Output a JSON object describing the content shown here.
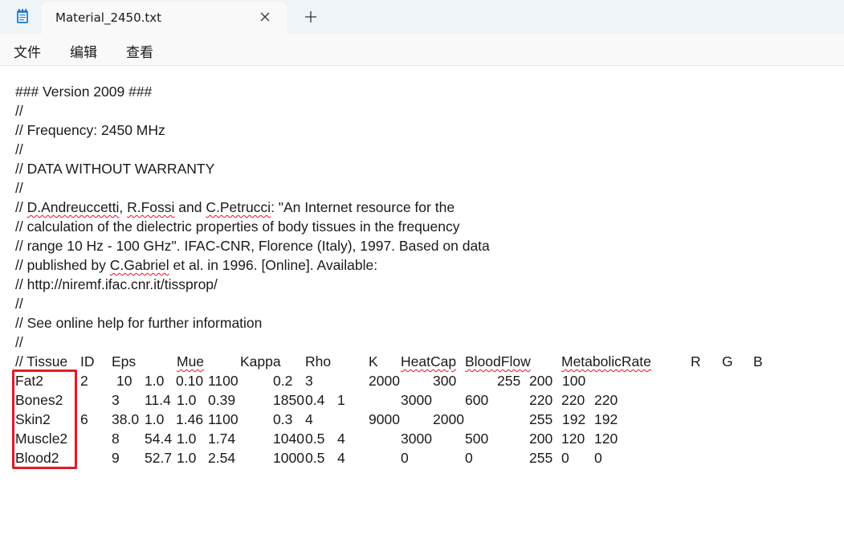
{
  "window": {
    "tab_title": "Material_2450.txt",
    "icons": {
      "app": "notepad-icon",
      "close": "close-icon",
      "new_tab": "plus-icon"
    }
  },
  "menu": {
    "file": "文件",
    "edit": "编辑",
    "view": "查看"
  },
  "header_lines": [
    "### Version 2009 ###",
    "//",
    "// Frequency: 2450 MHz",
    "//",
    "// DATA WITHOUT WARRANTY",
    "//",
    "// D.Andreuccetti, R.Fossi and C.Petrucci: \"An Internet resource for the",
    "// calculation of the dielectric properties of body tissues in the frequency",
    "// range 10 Hz - 100 GHz\". IFAC-CNR, Florence (Italy), 1997. Based on data",
    "// published by C.Gabriel et al. in 1996. [Online]. Available:",
    "// http://niremf.ifac.cnr.it/tissprop/",
    "//",
    "// See online help for further information",
    "//"
  ],
  "table": {
    "columns": [
      "// Tissue",
      "ID",
      "Eps",
      "Mue",
      "Kappa",
      "Rho",
      "K",
      "HeatCap",
      "BloodFlow",
      "MetabolicRate",
      "R",
      "G",
      "B"
    ],
    "rows": [
      {
        "name": "Fat2",
        "id": "2",
        "eps": "10",
        "mue": "1.0",
        "kappa": "0.10",
        "rho": "1100",
        "k": "0.2",
        "heatcap": "3",
        "bloodflow": "2000",
        "metabolic": "300",
        "r": "255",
        "g": "200",
        "b": "100"
      },
      {
        "name": "Bones2",
        "id": "3",
        "eps": "11.4",
        "mue": "1.0",
        "kappa": "0.39",
        "rho": "1850",
        "k": "0.4",
        "heatcap": "1",
        "bloodflow": "3000",
        "metabolic": "600",
        "r": "220",
        "g": "220",
        "b": "220"
      },
      {
        "name": "Skin2",
        "id": "6",
        "eps": "38.0",
        "mue": "1.0",
        "kappa": "1.46",
        "rho": "1100",
        "k": "0.3",
        "heatcap": "4",
        "bloodflow": "9000",
        "metabolic": "2000",
        "r": "255",
        "g": "192",
        "b": "192"
      },
      {
        "name": "Muscle2",
        "id": "8",
        "eps": "54.4",
        "mue": "1.0",
        "kappa": "1.74",
        "rho": "1040",
        "k": "0.5",
        "heatcap": "4",
        "bloodflow": "3000",
        "metabolic": "500",
        "r": "200",
        "g": "120",
        "b": "120"
      },
      {
        "name": "Blood2",
        "id": "9",
        "eps": "52.7",
        "mue": "1.0",
        "kappa": "2.54",
        "rho": "1000",
        "k": "0.5",
        "heatcap": "4",
        "bloodflow": "0",
        "metabolic": "0",
        "r": "255",
        "g": "0",
        "b": "0"
      }
    ]
  },
  "colors": {
    "highlight_box": "#e31b23",
    "spellcheck": "#e81123"
  }
}
